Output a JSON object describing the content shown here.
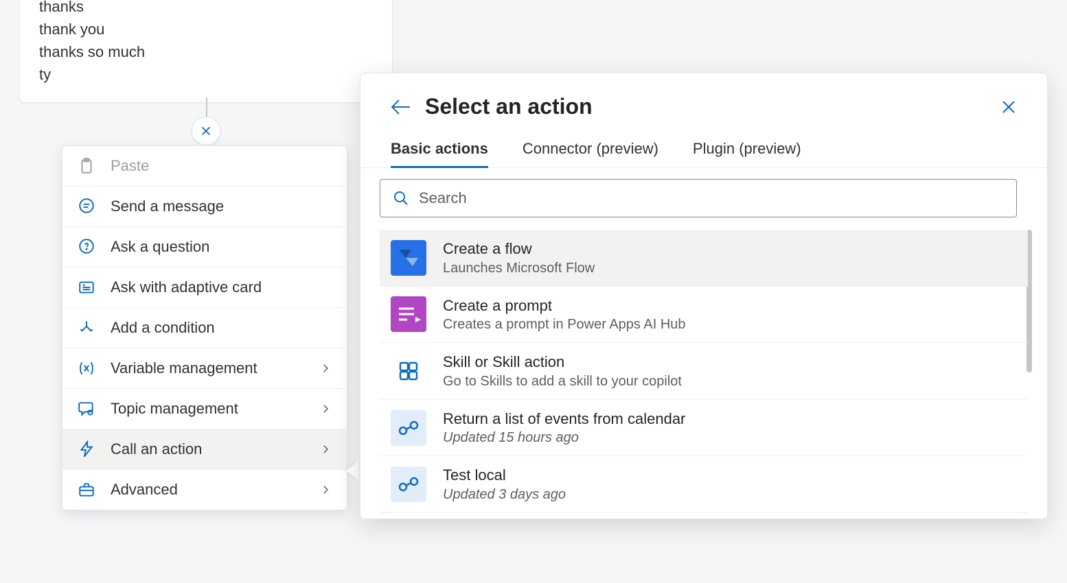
{
  "triggers": [
    "thanks",
    "thank you",
    "thanks so much",
    "ty"
  ],
  "contextMenu": [
    {
      "id": "paste",
      "label": "Paste",
      "icon": "clipboard",
      "disabled": true,
      "hasSubmenu": false
    },
    {
      "id": "send-message",
      "label": "Send a message",
      "icon": "chat",
      "hasSubmenu": false
    },
    {
      "id": "ask-question",
      "label": "Ask a question",
      "icon": "chat-question",
      "hasSubmenu": false
    },
    {
      "id": "ask-adaptive",
      "label": "Ask with adaptive card",
      "icon": "card",
      "hasSubmenu": false
    },
    {
      "id": "add-condition",
      "label": "Add a condition",
      "icon": "branch",
      "hasSubmenu": false
    },
    {
      "id": "variable-mgmt",
      "label": "Variable management",
      "icon": "variable",
      "hasSubmenu": true
    },
    {
      "id": "topic-mgmt",
      "label": "Topic management",
      "icon": "gear-chat",
      "hasSubmenu": true
    },
    {
      "id": "call-action",
      "label": "Call an action",
      "icon": "bolt",
      "hasSubmenu": true,
      "selected": true
    },
    {
      "id": "advanced",
      "label": "Advanced",
      "icon": "briefcase",
      "hasSubmenu": true
    }
  ],
  "panel": {
    "title": "Select an action",
    "tabs": [
      {
        "id": "basic",
        "label": "Basic actions",
        "active": true
      },
      {
        "id": "connector",
        "label": "Connector (preview)"
      },
      {
        "id": "plugin",
        "label": "Plugin (preview)"
      }
    ],
    "searchPlaceholder": "Search",
    "actions": [
      {
        "id": "create-flow",
        "title": "Create a flow",
        "sub": "Launches Microsoft Flow",
        "iconColor": "#2670e8",
        "iconType": "flow",
        "selected": true
      },
      {
        "id": "create-prompt",
        "title": "Create a prompt",
        "sub": "Creates a prompt in Power Apps AI Hub",
        "iconColor": "#b146c2",
        "iconType": "prompt"
      },
      {
        "id": "skill",
        "title": "Skill or Skill action",
        "sub": "Go to Skills to add a skill to your copilot",
        "iconColor": "transparent",
        "iconType": "skill"
      },
      {
        "id": "calendar-events",
        "title": "Return a list of events from calendar",
        "sub": "Updated 15 hours ago",
        "italic": true,
        "iconColor": "#e1edf9",
        "iconType": "flow-small"
      },
      {
        "id": "test-local",
        "title": "Test local",
        "sub": "Updated 3 days ago",
        "italic": true,
        "iconColor": "#e1edf9",
        "iconType": "flow-small"
      }
    ]
  }
}
